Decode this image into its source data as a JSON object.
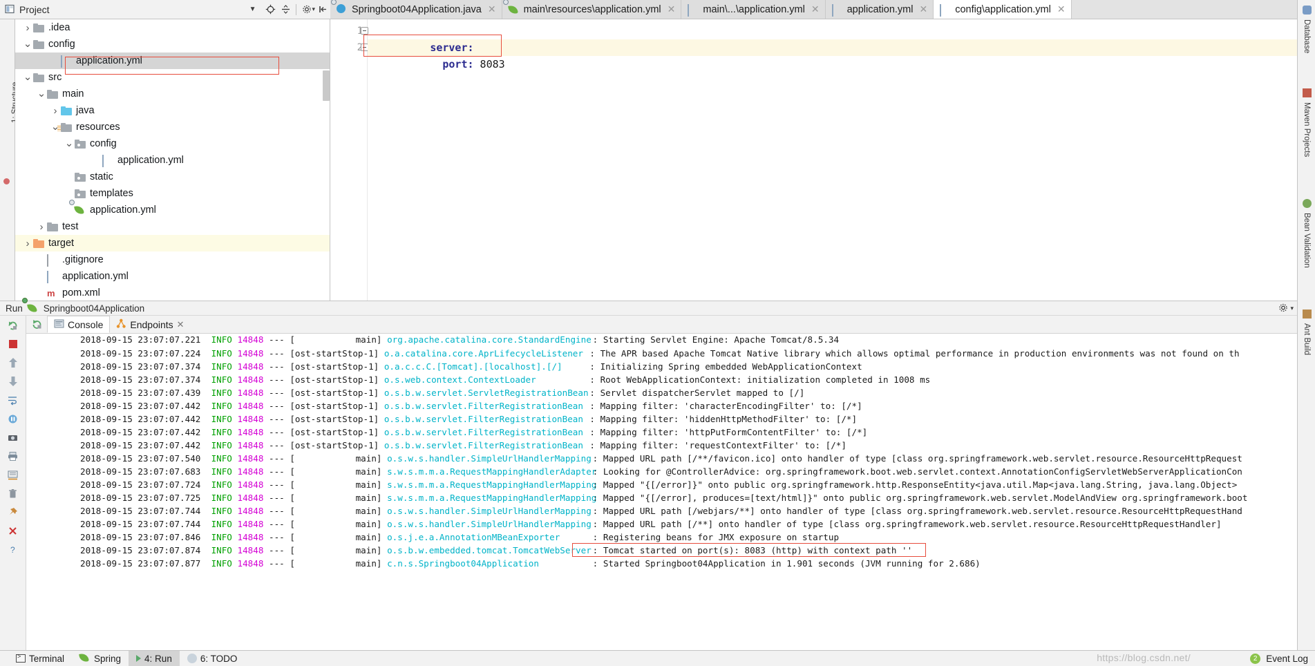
{
  "project_toolbar": {
    "title": "Project",
    "icons": [
      "project-view-icon",
      "chevron-down-icon",
      "locate-icon",
      "collapse-all-icon",
      "settings-gear-icon",
      "hide-icon"
    ]
  },
  "editor_tabs": [
    {
      "label": "Springboot04Application.java",
      "icon": "java-class-icon",
      "active": false,
      "closable": true
    },
    {
      "label": "main\\resources\\application.yml",
      "icon": "spring-leaf-icon",
      "active": false,
      "closable": true
    },
    {
      "label": "main\\...\\application.yml",
      "icon": "yml-file-icon",
      "active": false,
      "closable": true
    },
    {
      "label": "application.yml",
      "icon": "yml-file-icon",
      "active": false,
      "closable": true
    },
    {
      "label": "config\\application.yml",
      "icon": "yml-file-icon",
      "active": true,
      "closable": true
    }
  ],
  "left_rail": {
    "label": "1: Structure"
  },
  "project_tree": {
    "items": [
      {
        "label": ".idea",
        "indent": 1,
        "arrow": "collapsed",
        "icon": "folder-gray",
        "state": "normal"
      },
      {
        "label": "config",
        "indent": 1,
        "arrow": "expanded",
        "icon": "folder-gray",
        "state": "normal"
      },
      {
        "label": "application.yml",
        "indent": 3,
        "arrow": "none",
        "icon": "yml-file-icon",
        "state": "selected"
      },
      {
        "label": "src",
        "indent": 1,
        "arrow": "expanded",
        "icon": "folder-gray",
        "state": "normal"
      },
      {
        "label": "main",
        "indent": 2,
        "arrow": "expanded",
        "icon": "folder-gray",
        "state": "normal"
      },
      {
        "label": "java",
        "indent": 3,
        "arrow": "collapsed",
        "icon": "folder-blue",
        "state": "normal"
      },
      {
        "label": "resources",
        "indent": 3,
        "arrow": "expanded",
        "icon": "folder-resources",
        "state": "normal"
      },
      {
        "label": "config",
        "indent": 4,
        "arrow": "expanded",
        "icon": "folder-dot",
        "state": "normal"
      },
      {
        "label": "application.yml",
        "indent": 6,
        "arrow": "none",
        "icon": "yml-file-icon",
        "state": "normal"
      },
      {
        "label": "static",
        "indent": 4,
        "arrow": "none",
        "icon": "folder-dot",
        "state": "normal"
      },
      {
        "label": "templates",
        "indent": 4,
        "arrow": "none",
        "icon": "folder-dot",
        "state": "normal"
      },
      {
        "label": "application.yml",
        "indent": 4,
        "arrow": "none",
        "icon": "spring-leaf-icon",
        "state": "normal"
      },
      {
        "label": "test",
        "indent": 2,
        "arrow": "collapsed",
        "icon": "folder-gray",
        "state": "normal"
      },
      {
        "label": "target",
        "indent": 1,
        "arrow": "collapsed",
        "icon": "folder-orange",
        "state": "highlight"
      },
      {
        "label": ".gitignore",
        "indent": 2,
        "arrow": "none",
        "icon": "doc-icon",
        "state": "normal"
      },
      {
        "label": "application.yml",
        "indent": 2,
        "arrow": "none",
        "icon": "yml-file-icon",
        "state": "normal"
      },
      {
        "label": "pom.xml",
        "indent": 2,
        "arrow": "none",
        "icon": "maven-icon",
        "state": "normal"
      }
    ]
  },
  "editor": {
    "line_numbers": [
      "1",
      "2"
    ],
    "lines": [
      {
        "indent": "",
        "key": "server:",
        "value": ""
      },
      {
        "indent": "  ",
        "key": "port:",
        "value": " 8083"
      }
    ],
    "raw_line1": "server:",
    "raw_line2_key": "  port:",
    "raw_line2_val": " 8083",
    "inspection_status": "ok-checkmark"
  },
  "run_panel": {
    "header_label": "Run",
    "config_name": "Springboot04Application",
    "header_icons": [
      "spring-run-icon",
      "settings-gear-icon",
      "hide-icon"
    ],
    "tabs": [
      {
        "label": "Console",
        "icon": "console-icon",
        "active": true,
        "closable": false
      },
      {
        "label": "Endpoints",
        "icon": "endpoints-icon",
        "active": false,
        "closable": true
      }
    ],
    "toolbar_icons": [
      "rerun-icon",
      "stop-icon",
      "up-arrow-icon",
      "down-arrow-icon",
      "pause-icon",
      "down-nav-icon",
      "camera-icon",
      "printer-icon",
      "soft-wrap-icon",
      "scroll-end-icon",
      "print-icon",
      "trash-icon",
      "pin-icon",
      "close-icon",
      "help-icon"
    ]
  },
  "console": {
    "lines": [
      {
        "ts": "2018-09-15 23:07:07.221",
        "level": "INFO",
        "pid": "14848",
        "thread": "main",
        "logger": "org.apache.catalina.core.StandardEngine",
        "msg": "Starting Servlet Engine: Apache Tomcat/8.5.34",
        "clipped_top": true
      },
      {
        "ts": "2018-09-15 23:07:07.224",
        "level": "INFO",
        "pid": "14848",
        "thread": "ost-startStop-1",
        "logger": "o.a.catalina.core.AprLifecycleListener",
        "msg": "The APR based Apache Tomcat Native library which allows optimal performance in production environments was not found on th"
      },
      {
        "ts": "2018-09-15 23:07:07.374",
        "level": "INFO",
        "pid": "14848",
        "thread": "ost-startStop-1",
        "logger": "o.a.c.c.C.[Tomcat].[localhost].[/]",
        "msg": "Initializing Spring embedded WebApplicationContext"
      },
      {
        "ts": "2018-09-15 23:07:07.374",
        "level": "INFO",
        "pid": "14848",
        "thread": "ost-startStop-1",
        "logger": "o.s.web.context.ContextLoader",
        "msg": "Root WebApplicationContext: initialization completed in 1008 ms"
      },
      {
        "ts": "2018-09-15 23:07:07.439",
        "level": "INFO",
        "pid": "14848",
        "thread": "ost-startStop-1",
        "logger": "o.s.b.w.servlet.ServletRegistrationBean",
        "msg": "Servlet dispatcherServlet mapped to [/]"
      },
      {
        "ts": "2018-09-15 23:07:07.442",
        "level": "INFO",
        "pid": "14848",
        "thread": "ost-startStop-1",
        "logger": "o.s.b.w.servlet.FilterRegistrationBean",
        "msg": "Mapping filter: 'characterEncodingFilter' to: [/*]"
      },
      {
        "ts": "2018-09-15 23:07:07.442",
        "level": "INFO",
        "pid": "14848",
        "thread": "ost-startStop-1",
        "logger": "o.s.b.w.servlet.FilterRegistrationBean",
        "msg": "Mapping filter: 'hiddenHttpMethodFilter' to: [/*]"
      },
      {
        "ts": "2018-09-15 23:07:07.442",
        "level": "INFO",
        "pid": "14848",
        "thread": "ost-startStop-1",
        "logger": "o.s.b.w.servlet.FilterRegistrationBean",
        "msg": "Mapping filter: 'httpPutFormContentFilter' to: [/*]"
      },
      {
        "ts": "2018-09-15 23:07:07.442",
        "level": "INFO",
        "pid": "14848",
        "thread": "ost-startStop-1",
        "logger": "o.s.b.w.servlet.FilterRegistrationBean",
        "msg": "Mapping filter: 'requestContextFilter' to: [/*]"
      },
      {
        "ts": "2018-09-15 23:07:07.540",
        "level": "INFO",
        "pid": "14848",
        "thread": "main",
        "logger": "o.s.w.s.handler.SimpleUrlHandlerMapping",
        "msg": "Mapped URL path [/**/favicon.ico] onto handler of type [class org.springframework.web.servlet.resource.ResourceHttpRequest"
      },
      {
        "ts": "2018-09-15 23:07:07.683",
        "level": "INFO",
        "pid": "14848",
        "thread": "main",
        "logger": "s.w.s.m.m.a.RequestMappingHandlerAdapter",
        "msg": "Looking for @ControllerAdvice: org.springframework.boot.web.servlet.context.AnnotationConfigServletWebServerApplicationCon"
      },
      {
        "ts": "2018-09-15 23:07:07.724",
        "level": "INFO",
        "pid": "14848",
        "thread": "main",
        "logger": "s.w.s.m.m.a.RequestMappingHandlerMapping",
        "msg": "Mapped \"{[/error]}\" onto public org.springframework.http.ResponseEntity<java.util.Map<java.lang.String, java.lang.Object>"
      },
      {
        "ts": "2018-09-15 23:07:07.725",
        "level": "INFO",
        "pid": "14848",
        "thread": "main",
        "logger": "s.w.s.m.m.a.RequestMappingHandlerMapping",
        "msg": "Mapped \"{[/error], produces=[text/html]}\" onto public org.springframework.web.servlet.ModelAndView org.springframework.boot"
      },
      {
        "ts": "2018-09-15 23:07:07.744",
        "level": "INFO",
        "pid": "14848",
        "thread": "main",
        "logger": "o.s.w.s.handler.SimpleUrlHandlerMapping",
        "msg": "Mapped URL path [/webjars/**] onto handler of type [class org.springframework.web.servlet.resource.ResourceHttpRequestHand"
      },
      {
        "ts": "2018-09-15 23:07:07.744",
        "level": "INFO",
        "pid": "14848",
        "thread": "main",
        "logger": "o.s.w.s.handler.SimpleUrlHandlerMapping",
        "msg": "Mapped URL path [/**] onto handler of type [class org.springframework.web.servlet.resource.ResourceHttpRequestHandler]"
      },
      {
        "ts": "2018-09-15 23:07:07.846",
        "level": "INFO",
        "pid": "14848",
        "thread": "main",
        "logger": "o.s.j.e.a.AnnotationMBeanExporter",
        "msg": "Registering beans for JMX exposure on startup"
      },
      {
        "ts": "2018-09-15 23:07:07.874",
        "level": "INFO",
        "pid": "14848",
        "thread": "main",
        "logger": "o.s.b.w.embedded.tomcat.TomcatWebServer",
        "msg": "Tomcat started on port(s): 8083 (http) with context path ''",
        "highlighted": true
      },
      {
        "ts": "2018-09-15 23:07:07.877",
        "level": "INFO",
        "pid": "14848",
        "thread": "main",
        "logger": "c.n.s.Springboot04Application",
        "msg": "Started Springboot04Application in 1.901 seconds (JVM running for 2.686)"
      }
    ]
  },
  "right_sidebar": {
    "items": [
      {
        "label": "Database",
        "icon": "database-icon"
      },
      {
        "label": "Maven Projects",
        "icon": "maven-icon"
      },
      {
        "label": "Bean Validation",
        "icon": "bean-icon"
      },
      {
        "label": "Ant Build",
        "icon": "ant-icon"
      }
    ]
  },
  "status_bar": {
    "items": [
      {
        "label": "Terminal",
        "icon": "terminal-icon",
        "active": false
      },
      {
        "label": "Spring",
        "icon": "spring-leaf-icon",
        "active": false
      },
      {
        "label": "4: Run",
        "icon": "run-play-icon",
        "active": true
      },
      {
        "label": "6: TODO",
        "icon": "todo-icon",
        "active": false
      }
    ],
    "event_log": "Event Log",
    "event_log_count": "2",
    "watermark": "https://blog.csdn.net/"
  },
  "colors": {
    "accent_red": "#e74c3c",
    "level_info": "#00a000",
    "pid": "#d400d4",
    "logger": "#00b3c8",
    "selection": "#d5d5d5",
    "highlight_row": "#fdfbe4",
    "spring_green": "#6db33f"
  }
}
